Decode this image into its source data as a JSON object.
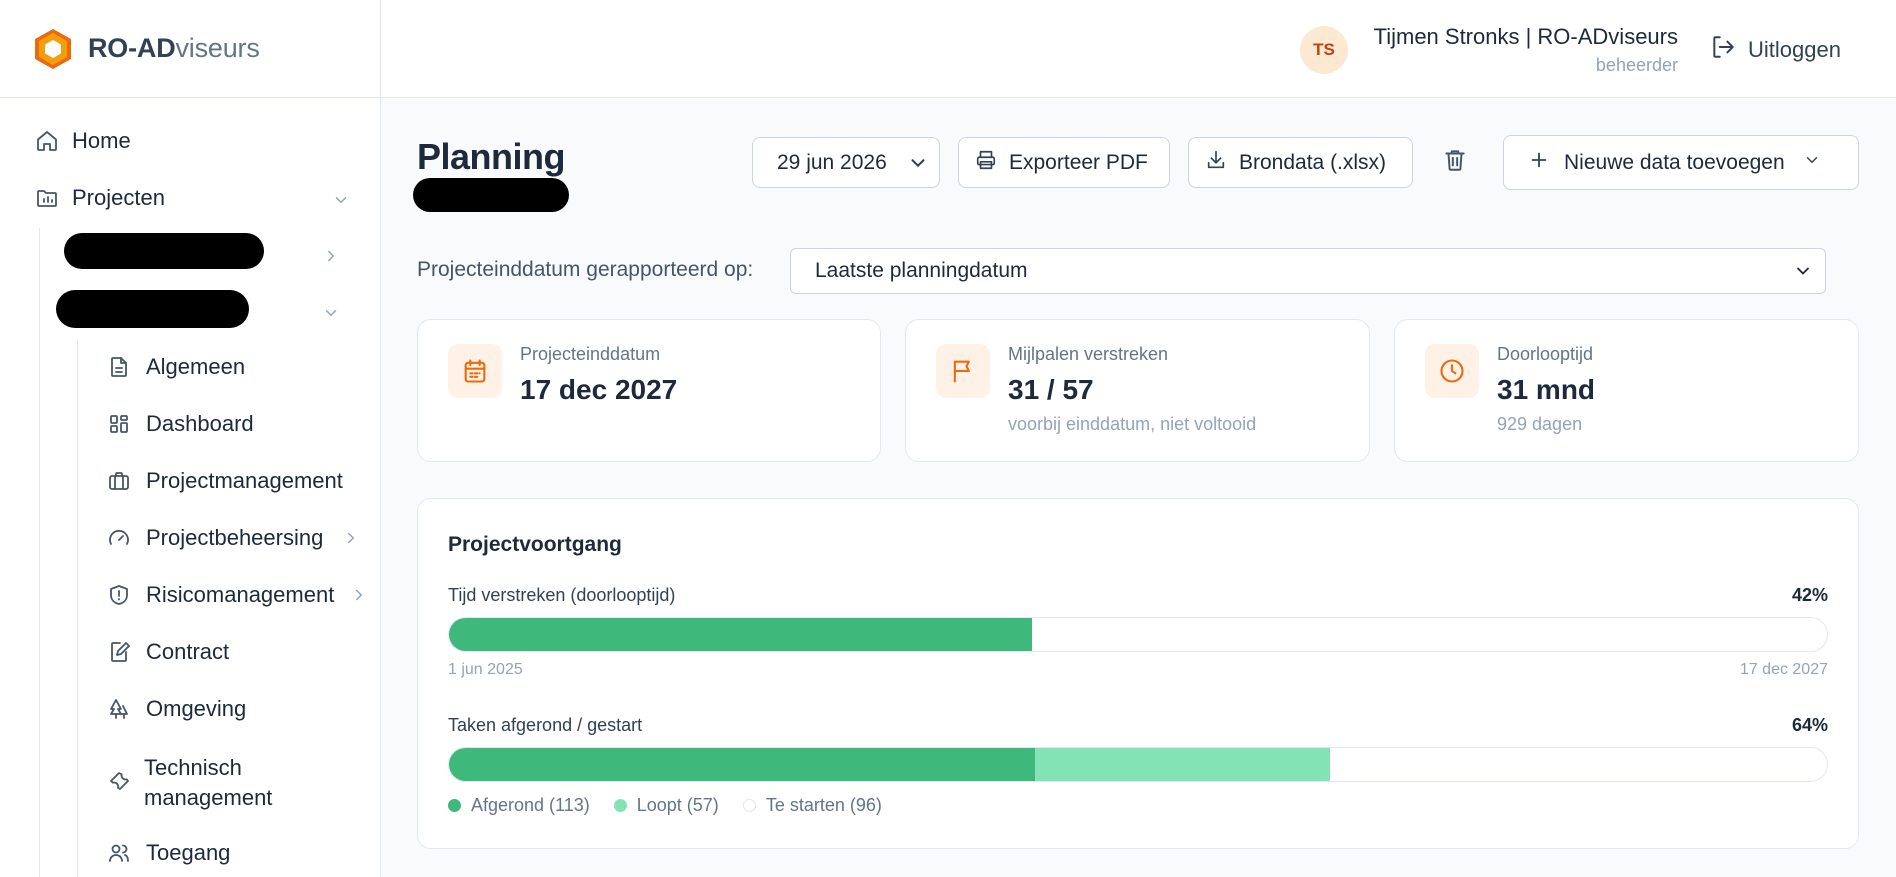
{
  "brand": {
    "name_bold": "RO-AD",
    "name_light": "viseurs",
    "color": "#ea6a0c"
  },
  "user": {
    "initials": "TS",
    "name": "Tijmen Stronks | RO-ADviseurs",
    "role": "beheerder",
    "logout_label": "Uitloggen"
  },
  "sidebar": {
    "home": "Home",
    "projects": "Projecten",
    "sub_items": [
      {
        "label": "Algemeen",
        "icon": "document-icon"
      },
      {
        "label": "Dashboard",
        "icon": "dashboard-icon"
      },
      {
        "label": "Projectmanagement",
        "icon": "briefcase-icon"
      },
      {
        "label": "Projectbeheersing",
        "icon": "gauge-icon"
      },
      {
        "label": "Risicomanagement",
        "icon": "shield-icon"
      },
      {
        "label": "Contract",
        "icon": "contract-icon"
      },
      {
        "label": "Omgeving",
        "icon": "trees-icon"
      },
      {
        "label": "Technisch management",
        "icon": "wrench-icon"
      },
      {
        "label": "Toegang",
        "icon": "users-icon"
      }
    ]
  },
  "main": {
    "title": "Planning",
    "date_select": "29 jun 2026",
    "export_pdf": "Exporteer PDF",
    "source_data": "Brondata (.xlsx)",
    "new_data": "Nieuwe data toevoegen",
    "filter_label": "Projecteinddatum gerapporteerd op:",
    "filter_value": "Laatste planningdatum"
  },
  "stats": [
    {
      "label": "Projecteinddatum",
      "value": "17 dec 2027",
      "sub": ""
    },
    {
      "label": "Mijlpalen verstreken",
      "value": "31 / 57",
      "sub": "voorbij einddatum, niet voltooid"
    },
    {
      "label": "Doorlooptijd",
      "value": "31 mnd",
      "sub": "929 dagen"
    }
  ],
  "progress": {
    "title": "Projectvoortgang",
    "time": {
      "label": "Tijd verstreken (doorlooptijd)",
      "pct_label": "42%",
      "fraction": 0.423,
      "start": "1 jun 2025",
      "end": "17 dec 2027"
    },
    "tasks": {
      "label": "Taken afgerond / gestart",
      "pct_label": "64%",
      "done_fraction": 0.425,
      "running_fraction": 0.214
    },
    "legend": [
      {
        "label": "Afgerond (113)",
        "color": "#3fb87b"
      },
      {
        "label": "Loopt (57)",
        "color": "#84e3b5"
      },
      {
        "label": "Te starten (96)",
        "color": "#ffffff"
      }
    ]
  }
}
